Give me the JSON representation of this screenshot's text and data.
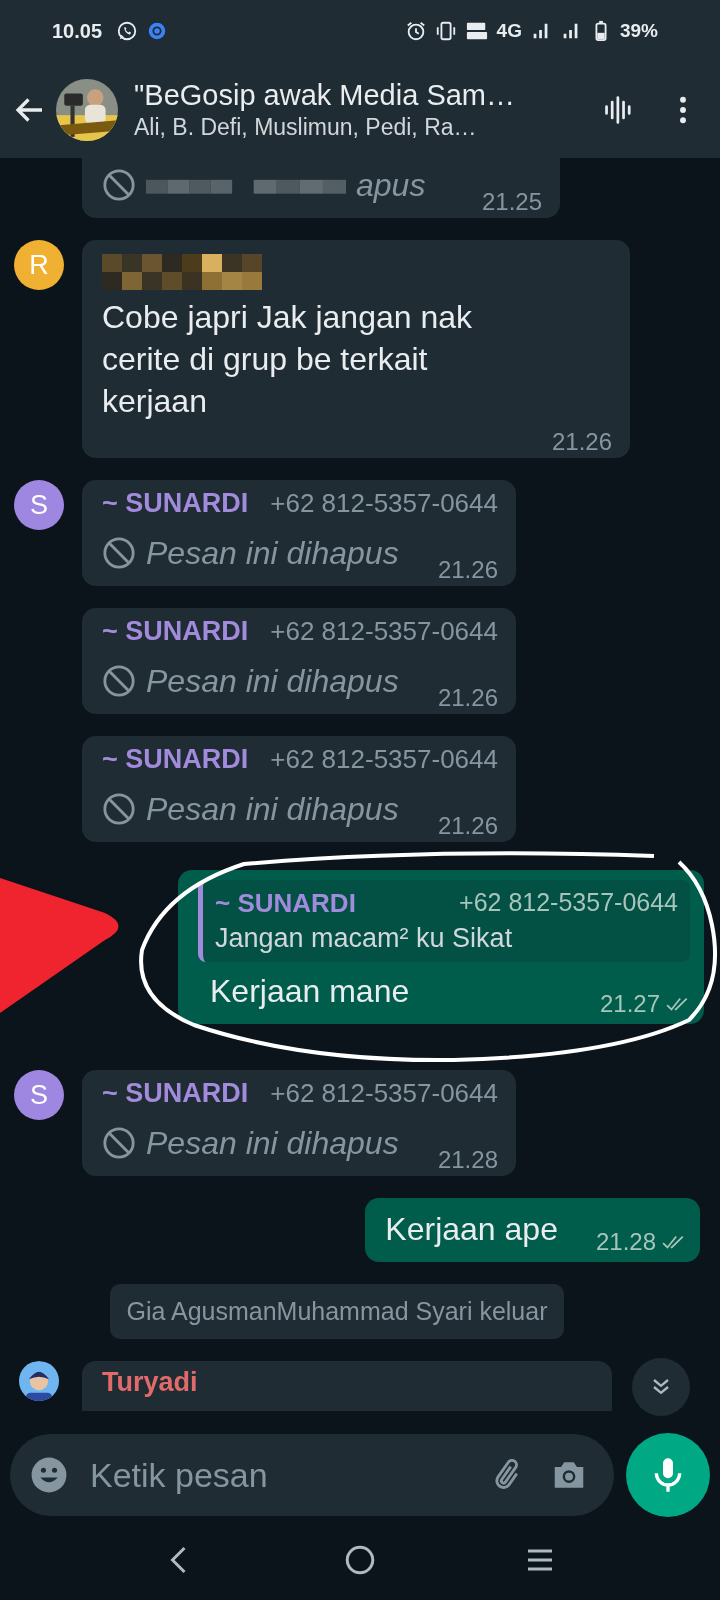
{
  "status_bar": {
    "time": "10.05",
    "network": "4G",
    "battery": "39%"
  },
  "header": {
    "title": "\"BeGosip awak Media Sam…",
    "subtitle": "Ali, B. Defi, Muslimun, Pedi, Ra…"
  },
  "messages": [
    {
      "kind": "incoming",
      "cut_top": true,
      "deleted": true,
      "redacted": true,
      "text": "apus",
      "time": "21.25"
    },
    {
      "kind": "incoming",
      "avatar": {
        "kind": "letter",
        "letter": "R",
        "color": "#f0b132"
      },
      "sender": {
        "redacted": true
      },
      "text": "Cobe japri Jak jangan nak cerite di grup be terkait kerjaan",
      "time": "21.26"
    },
    {
      "kind": "incoming",
      "avatar": {
        "kind": "letter",
        "letter": "S",
        "color": "#9d87e0"
      },
      "sender": {
        "name": "~ SUNARDI",
        "phone": "+62 812-5357-0644",
        "color": "#a28bdc"
      },
      "deleted": true,
      "text": "Pesan ini dihapus",
      "time": "21.26"
    },
    {
      "kind": "incoming",
      "sender": {
        "name": "~ SUNARDI",
        "phone": "+62 812-5357-0644",
        "color": "#a28bdc"
      },
      "deleted": true,
      "text": "Pesan ini dihapus",
      "time": "21.26"
    },
    {
      "kind": "incoming",
      "sender": {
        "name": "~ SUNARDI",
        "phone": "+62 812-5357-0644",
        "color": "#a28bdc"
      },
      "deleted": true,
      "text": "Pesan ini dihapus",
      "time": "21.26"
    },
    {
      "kind": "outgoing",
      "quote": {
        "name": "~ SUNARDI",
        "phone": "+62 812-5357-0644",
        "text": "Jangan macam² ku Sikat",
        "color": "#a28bdc"
      },
      "text": "Kerjaan mane",
      "time": "21.27",
      "read": false
    },
    {
      "kind": "incoming",
      "avatar": {
        "kind": "letter",
        "letter": "S",
        "color": "#9d87e0"
      },
      "sender": {
        "name": "~ SUNARDI",
        "phone": "+62 812-5357-0644",
        "color": "#a28bdc"
      },
      "deleted": true,
      "text": "Pesan ini dihapus",
      "time": "21.28"
    },
    {
      "kind": "outgoing",
      "text": "Kerjaan ape",
      "time": "21.28",
      "read": false
    },
    {
      "kind": "system",
      "text": "Gia AgusmanMuhammad Syari keluar"
    },
    {
      "kind": "incoming",
      "cut_bottom": true,
      "sender": {
        "name": "Turyadi",
        "color": "#e26a6a"
      }
    }
  ],
  "annotations": {
    "arrow": true,
    "ellipse": true
  },
  "composer": {
    "placeholder": "Ketik pesan"
  }
}
